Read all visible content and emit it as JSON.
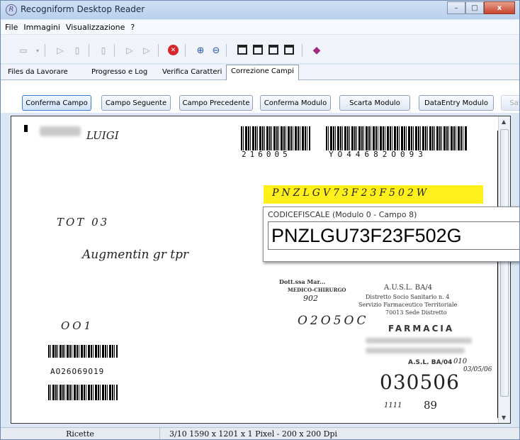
{
  "window": {
    "title": "Recogniform Desktop Reader",
    "app_icon": "R",
    "min": "–",
    "max": "□",
    "close": "x"
  },
  "menu": {
    "items": [
      "File",
      "Immagini",
      "Visualizzazione",
      "?"
    ]
  },
  "toolbar": {
    "icons": [
      "open-icon",
      "dropdown-icon",
      "scan-icon",
      "page-icon",
      "page-copy-icon",
      "prev-page-icon",
      "next-page-icon",
      "stop-icon",
      "zoom-in-icon",
      "zoom-out-icon",
      "fit-page-icon",
      "fit-width-icon",
      "fit-height-icon",
      "actual-size-icon",
      "book-icon"
    ]
  },
  "tabs": [
    {
      "label": "Files da Lavorare",
      "active": false
    },
    {
      "label": "Progresso e Log",
      "active": false
    },
    {
      "label": "Verifica Caratteri",
      "active": false
    },
    {
      "label": "Correzione Campi",
      "active": true
    }
  ],
  "buttons": {
    "conferma_campo": "Conferma Campo",
    "campo_seguente": "Campo Seguente",
    "campo_precedente": "Campo Precedente",
    "conferma_modulo": "Conferma Modulo",
    "scarta_modulo": "Scarta Modulo",
    "dataentry_modulo": "DataEntry Modulo",
    "sal": "Sal"
  },
  "document": {
    "handwriting_top": "LUIGI",
    "barcode1_number": "216005",
    "barcode2_number": "YO44682O093",
    "highlighted_field": "PNZLGV73F23F502W",
    "tot": "TOT 03",
    "signature": "Augmentin gr tpr",
    "code_001": "OO1",
    "code_barcode_text": "AO26O69O19",
    "stamp_doctor": "Dott.ssa Mar...",
    "stamp_medico": "MEDICO-CHIRURGO",
    "stamp_num": "902",
    "handwritten_num": "O2O5OC",
    "asl_title": "A.U.S.L. BA/4",
    "asl_line2": "Distretto Socio Sanitario n. 4",
    "asl_line3": "Servizio Farmaceutico Territoriale",
    "asl_line4": "70013 Sede Distretto",
    "farmacia": "FARMACIA",
    "asl_ba04": "A.S.L. BA/04",
    "asl_code": "010",
    "big_date": "030506",
    "small_date": "03/05/06",
    "bottom_num": "89",
    "bottom_left": "1111"
  },
  "popup": {
    "caption": "CODICEFISCALE (Modulo 0 - Campo 8)",
    "value": "PNZLGU73F23F502G"
  },
  "status": {
    "left": "Ricette",
    "right": "3/10 1590 x 1201 x 1 Pixel - 200 x 200 Dpi"
  }
}
